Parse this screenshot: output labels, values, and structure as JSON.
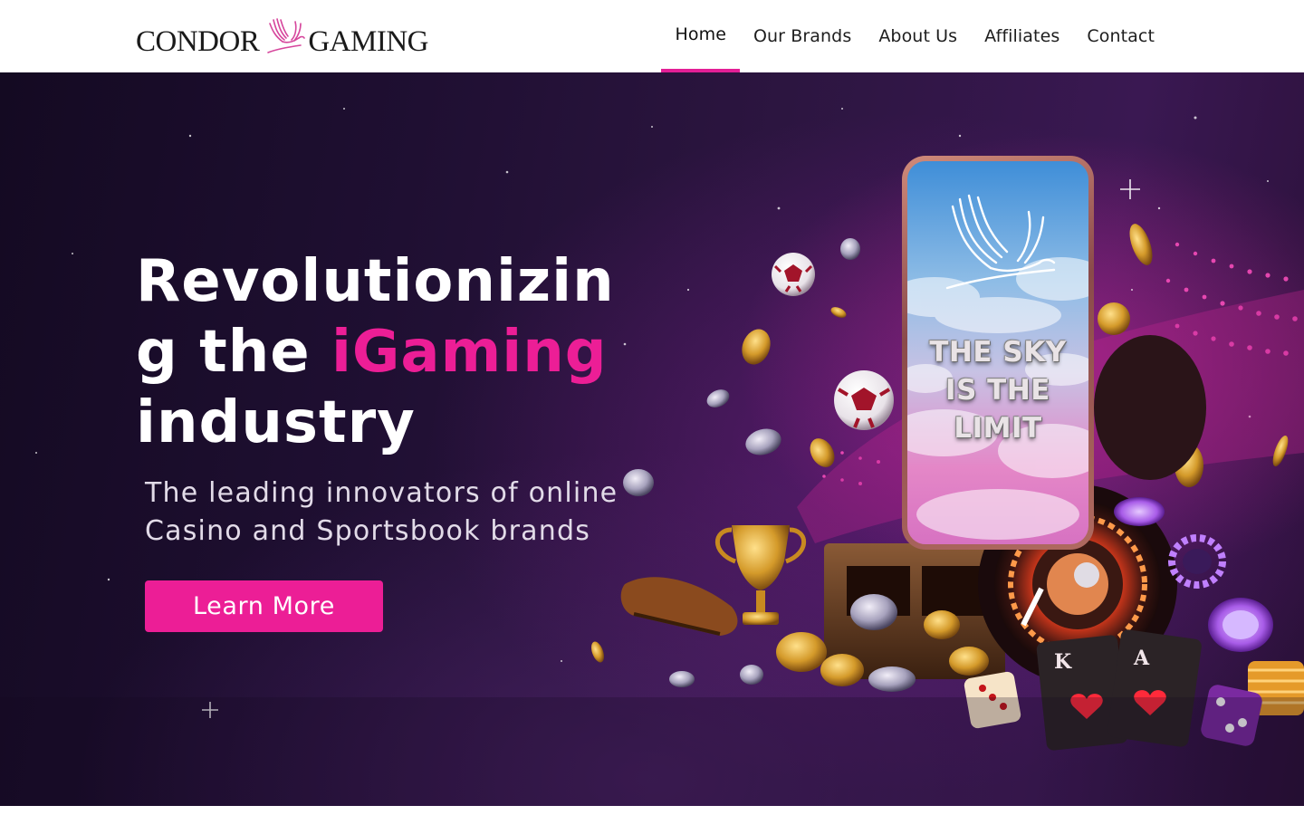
{
  "brand": {
    "name_left": "CONDOR",
    "name_right": "GAMING",
    "logo_icon": "condor-bird-icon",
    "accent_color": "#ec1e96"
  },
  "nav": {
    "items": [
      {
        "label": "Home",
        "active": true
      },
      {
        "label": "Our Brands",
        "active": false
      },
      {
        "label": "About Us",
        "active": false
      },
      {
        "label": "Affiliates",
        "active": false
      },
      {
        "label": "Contact",
        "active": false
      }
    ]
  },
  "hero": {
    "title_part1": "Revolutionizing the ",
    "title_accent": "iGaming",
    "title_part2": " industry",
    "subtitle": "The leading innovators of online Casino and Sportsbook brands",
    "cta_label": "Learn More",
    "phone_text": "THE SKY\nIS THE\nLIMIT"
  }
}
